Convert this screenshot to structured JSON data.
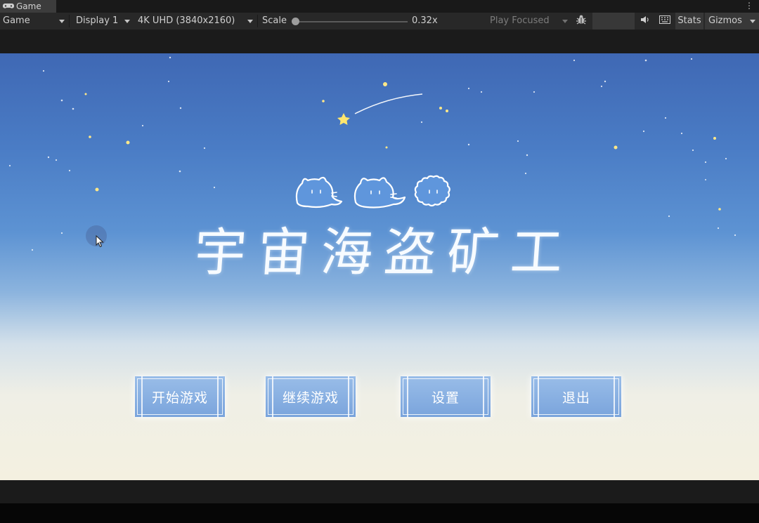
{
  "editor": {
    "tab_title": "Game",
    "tab_icon": "gamepad-icon",
    "toolbar": {
      "view_mode": "Game",
      "display": "Display 1",
      "resolution": "4K UHD (3840x2160)",
      "scale_label": "Scale",
      "scale_value_text": "0.32x",
      "scale_fraction": 0.0,
      "play_mode": "Play Focused",
      "stats_label": "Stats",
      "gizmos_label": "Gizmos",
      "icons": [
        "bug-icon",
        "speaker-icon",
        "keyboard-icon",
        "chevron-down-icon",
        "kebab-menu-icon"
      ]
    }
  },
  "game": {
    "title": "宇宙海盗矿工",
    "title_chars": [
      "宇",
      "宙",
      "海",
      "盗",
      "矿",
      "工"
    ],
    "mascots": [
      "cat-blob-icon",
      "cat-blob-icon",
      "fluffy-blob-icon"
    ],
    "menu": [
      {
        "label": "开始游戏"
      },
      {
        "label": "继续游戏"
      },
      {
        "label": "设置"
      },
      {
        "label": "退出"
      }
    ],
    "colors": {
      "sky_top": "#3f68b4",
      "sky_mid": "#5d93d3",
      "horizon": "#f4f0e0",
      "button_fill": "#88b0e2",
      "text": "#ffffff"
    }
  }
}
